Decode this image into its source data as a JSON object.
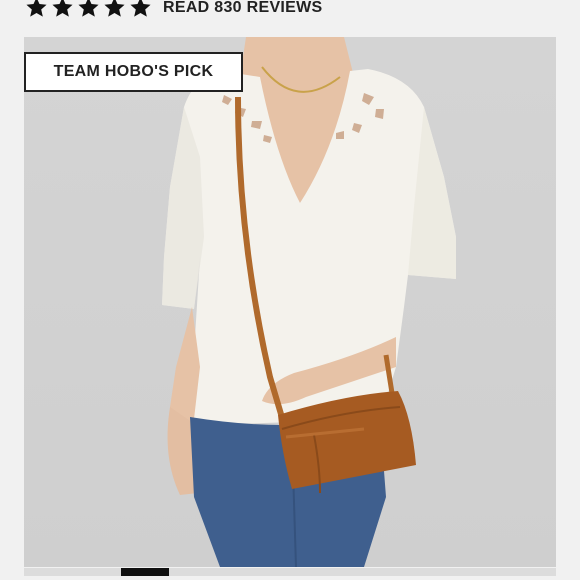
{
  "rating": {
    "stars": 5,
    "max": 5,
    "star_color": "#111111",
    "icon": "star-icon",
    "reviews_label": "READ 830 REVIEWS"
  },
  "badge": {
    "label": "TEAM HOBO'S PICK"
  },
  "product_image": {
    "colors": {
      "background": "#d3d3d3",
      "blouse": "#f4f2ec",
      "skin": "#e6c2a6",
      "jeans": "#3f5f8e",
      "bag": "#a65b22",
      "strap": "#b06a2c"
    }
  },
  "carousel": {
    "slide_count": 5,
    "active_index": 1
  }
}
